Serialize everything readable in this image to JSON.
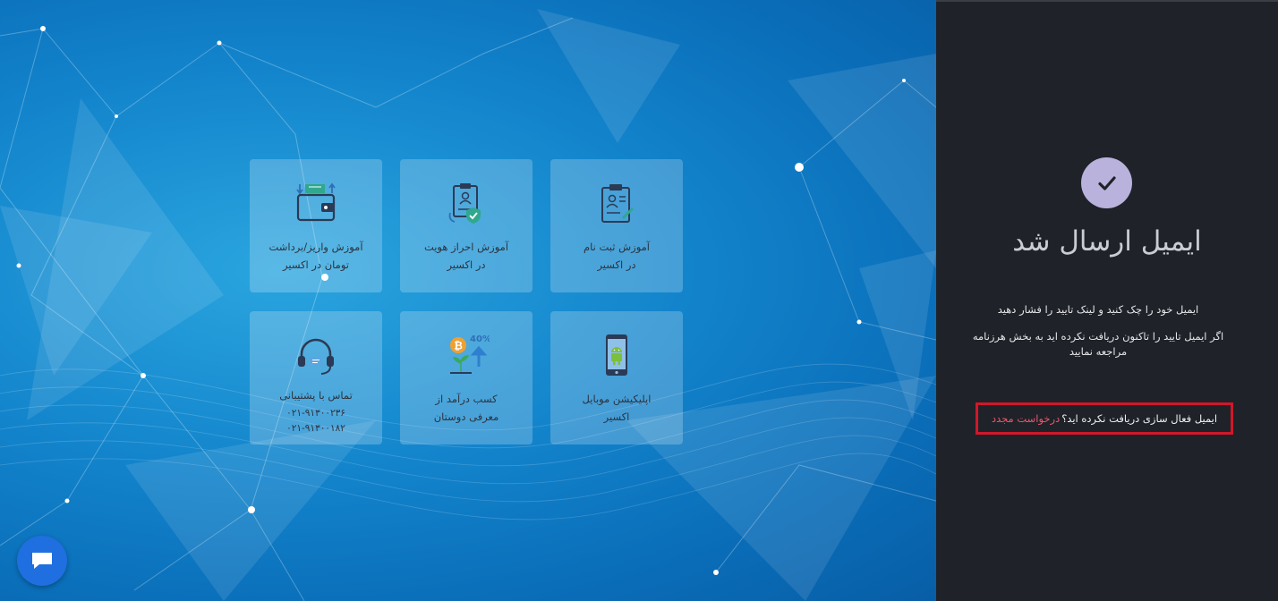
{
  "cards": [
    {
      "line1": "آموزش ثبت نام",
      "line2": "در اکسیر",
      "icon": "registration-clipboard-icon"
    },
    {
      "line1": "آموزش احراز هویت",
      "line2": "در اکسیر",
      "icon": "identity-verification-icon"
    },
    {
      "line1": "آموزش واریز/برداشت",
      "line2": "تومان در اکسیر",
      "icon": "wallet-icon"
    },
    {
      "line1": "اپلیکیشن موبایل",
      "line2": "اکسیر",
      "icon": "android-phone-icon"
    },
    {
      "line1": "کسب درآمد از",
      "line2": "معرفی دوستان",
      "icon": "bitcoin-growth-icon",
      "badge": "40%"
    },
    {
      "line1": "تماس با پشتیبانی",
      "line2": "۰۲۱-۹۱۳۰۰۲۳۶",
      "line3": "۰۲۱-۹۱۳۰۰۱۸۲",
      "icon": "headset-icon"
    }
  ],
  "panel": {
    "title": "ایمیل ارسال شد",
    "message1": "ایمیل خود را چک کنید و لینک تایید را فشار دهید",
    "message2": "اگر ایمیل تایید را تاکنون دریافت نکرده اید به بخش هرزنامه مراجعه نمایید",
    "resend_question": "ایمیل فعال سازی دریافت نکرده اید؟",
    "resend_link": "درخواست مجدد"
  },
  "colors": {
    "panel_bg": "#1f2229",
    "check_circle": "#b9b2dc",
    "link": "#e45a6a",
    "highlight_border": "#d0182a",
    "chat_button": "#1f6fe0"
  }
}
